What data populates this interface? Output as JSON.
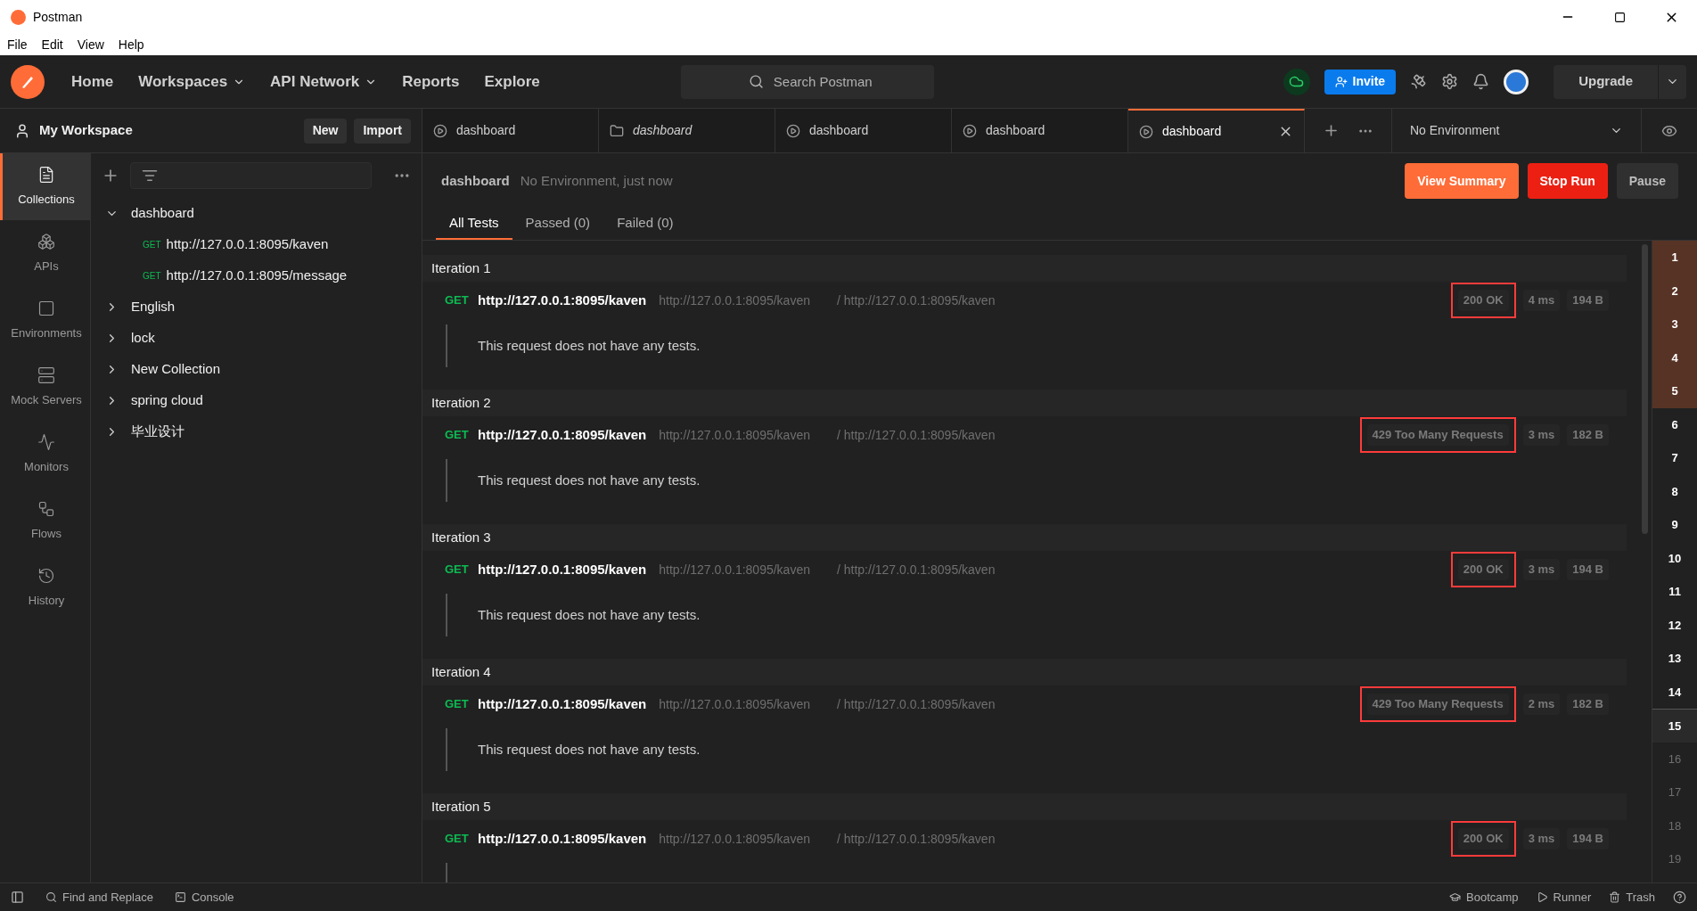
{
  "window": {
    "title": "Postman"
  },
  "menu": [
    "File",
    "Edit",
    "View",
    "Help"
  ],
  "header": {
    "nav": [
      {
        "label": "Home",
        "dropdown": false
      },
      {
        "label": "Workspaces",
        "dropdown": true
      },
      {
        "label": "API Network",
        "dropdown": true
      },
      {
        "label": "Reports",
        "dropdown": false
      },
      {
        "label": "Explore",
        "dropdown": false
      }
    ],
    "search": {
      "placeholder": "Search Postman"
    },
    "invite": "Invite",
    "upgrade": "Upgrade"
  },
  "workspace": {
    "name": "My Workspace",
    "buttons": [
      "New",
      "Import"
    ]
  },
  "tabs": [
    {
      "label": "dashboard",
      "kind": "runner",
      "preview": false,
      "selected": false
    },
    {
      "label": "dashboard",
      "kind": "collection",
      "preview": true,
      "selected": false
    },
    {
      "label": "dashboard",
      "kind": "runner",
      "preview": false,
      "selected": false
    },
    {
      "label": "dashboard",
      "kind": "runner",
      "preview": false,
      "selected": false
    },
    {
      "label": "dashboard",
      "kind": "runner",
      "preview": false,
      "selected": true
    }
  ],
  "environment": {
    "value": "No Environment"
  },
  "rail": [
    {
      "label": "Collections",
      "selected": true
    },
    {
      "label": "APIs",
      "selected": false
    },
    {
      "label": "Environments",
      "selected": false
    },
    {
      "label": "Mock Servers",
      "selected": false
    },
    {
      "label": "Monitors",
      "selected": false
    },
    {
      "label": "Flows",
      "selected": false
    },
    {
      "label": "History",
      "selected": false
    }
  ],
  "collections": [
    {
      "name": "dashboard",
      "expanded": true,
      "children": [
        {
          "method": "GET",
          "name": "http://127.0.0.1:8095/kaven"
        },
        {
          "method": "GET",
          "name": "http://127.0.0.1:8095/message"
        }
      ]
    },
    {
      "name": "English",
      "expanded": false
    },
    {
      "name": "lock",
      "expanded": false
    },
    {
      "name": "New Collection",
      "expanded": false
    },
    {
      "name": "spring cloud",
      "expanded": false
    },
    {
      "name": "毕业设计",
      "expanded": false
    }
  ],
  "run": {
    "name": "dashboard",
    "meta": "No Environment, just now",
    "buttons": [
      {
        "label": "View Summary",
        "kind": "summary"
      },
      {
        "label": "Stop Run",
        "kind": "stop"
      },
      {
        "label": "Pause",
        "kind": "pause"
      }
    ],
    "filters": [
      {
        "label": "All Tests",
        "selected": true
      },
      {
        "label": "Passed (0)",
        "selected": false
      },
      {
        "label": "Failed (0)",
        "selected": false
      }
    ],
    "iterations": [
      {
        "title": "Iteration 1",
        "method": "GET",
        "name": "http://127.0.0.1:8095/kaven",
        "url": "http://127.0.0.1:8095/kaven",
        "path": "/ http://127.0.0.1:8095/kaven",
        "status": "200 OK",
        "highlighted": true,
        "time": "4 ms",
        "size": "194 B",
        "message": "This request does not have any tests."
      },
      {
        "title": "Iteration 2",
        "method": "GET",
        "name": "http://127.0.0.1:8095/kaven",
        "url": "http://127.0.0.1:8095/kaven",
        "path": "/ http://127.0.0.1:8095/kaven",
        "status": "429 Too Many Requests",
        "highlighted": true,
        "time": "3 ms",
        "size": "182 B",
        "message": "This request does not have any tests."
      },
      {
        "title": "Iteration 3",
        "method": "GET",
        "name": "http://127.0.0.1:8095/kaven",
        "url": "http://127.0.0.1:8095/kaven",
        "path": "/ http://127.0.0.1:8095/kaven",
        "status": "200 OK",
        "highlighted": true,
        "time": "3 ms",
        "size": "194 B",
        "message": "This request does not have any tests."
      },
      {
        "title": "Iteration 4",
        "method": "GET",
        "name": "http://127.0.0.1:8095/kaven",
        "url": "http://127.0.0.1:8095/kaven",
        "path": "/ http://127.0.0.1:8095/kaven",
        "status": "429 Too Many Requests",
        "highlighted": true,
        "time": "2 ms",
        "size": "182 B",
        "message": "This request does not have any tests."
      },
      {
        "title": "Iteration 5",
        "method": "GET",
        "name": "http://127.0.0.1:8095/kaven",
        "url": "http://127.0.0.1:8095/kaven",
        "path": "/ http://127.0.0.1:8095/kaven",
        "status": "200 OK",
        "highlighted": true,
        "time": "3 ms",
        "size": "194 B"
      }
    ],
    "iteration_numbers": [
      {
        "label": "1",
        "in_view": true,
        "done": true,
        "selected": false
      },
      {
        "label": "2",
        "in_view": true,
        "done": true,
        "selected": false
      },
      {
        "label": "3",
        "in_view": true,
        "done": true,
        "selected": false
      },
      {
        "label": "4",
        "in_view": true,
        "done": true,
        "selected": false
      },
      {
        "label": "5",
        "in_view": true,
        "done": true,
        "selected": false
      },
      {
        "label": "6",
        "in_view": false,
        "done": true,
        "selected": false
      },
      {
        "label": "7",
        "in_view": false,
        "done": true,
        "selected": false
      },
      {
        "label": "8",
        "in_view": false,
        "done": true,
        "selected": false
      },
      {
        "label": "9",
        "in_view": false,
        "done": true,
        "selected": false
      },
      {
        "label": "10",
        "in_view": false,
        "done": true,
        "selected": false
      },
      {
        "label": "11",
        "in_view": false,
        "done": true,
        "selected": false
      },
      {
        "label": "12",
        "in_view": false,
        "done": true,
        "selected": false
      },
      {
        "label": "13",
        "in_view": false,
        "done": true,
        "selected": false
      },
      {
        "label": "14",
        "in_view": false,
        "done": true,
        "selected": false
      },
      {
        "label": "15",
        "in_view": false,
        "done": true,
        "selected": true
      },
      {
        "label": "16",
        "in_view": false,
        "done": false,
        "selected": false
      },
      {
        "label": "17",
        "in_view": false,
        "done": false,
        "selected": false
      },
      {
        "label": "18",
        "in_view": false,
        "done": false,
        "selected": false
      },
      {
        "label": "19",
        "in_view": false,
        "done": false,
        "selected": false
      }
    ]
  },
  "status_bar": {
    "left": [
      "Find and Replace",
      "Console"
    ],
    "right": [
      "Bootcamp",
      "Runner",
      "Trash"
    ]
  }
}
